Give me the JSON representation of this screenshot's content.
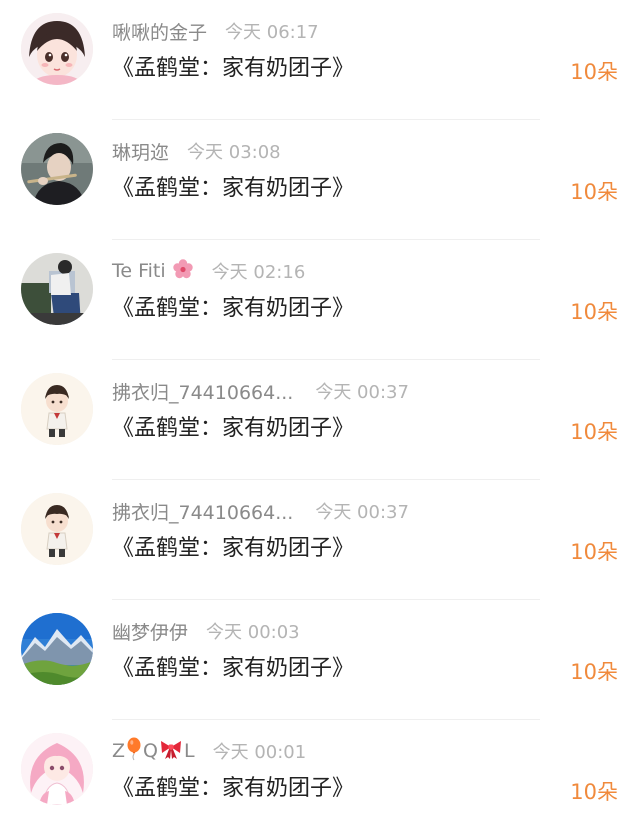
{
  "colors": {
    "username": "#8a8a8a",
    "time": "#b4b4b4",
    "title": "#222222",
    "count": "#f08a3c"
  },
  "rows": [
    {
      "username": "啾啾的金子",
      "time": "今天 06:17",
      "title": "《孟鹤堂：家有奶团子》",
      "count": "10朵",
      "avatar": "cartoon-girl-avatar"
    },
    {
      "username": "琳玥迩",
      "time": "今天 03:08",
      "title": "《孟鹤堂：家有奶团子》",
      "count": "10朵",
      "avatar": "flute-player-avatar"
    },
    {
      "username": "Te Fiti",
      "username_emoji": "flower-icon",
      "time": "今天 02:16",
      "title": "《孟鹤堂：家有奶团子》",
      "count": "10朵",
      "avatar": "photo-person-avatar"
    },
    {
      "username": "拂衣归_74410664...",
      "time": "今天 00:37",
      "title": "《孟鹤堂：家有奶团子》",
      "count": "10朵",
      "avatar": "chibi-boy-avatar"
    },
    {
      "username": "拂衣归_74410664...",
      "time": "今天 00:37",
      "title": "《孟鹤堂：家有奶团子》",
      "count": "10朵",
      "avatar": "chibi-boy-avatar"
    },
    {
      "username": "幽梦伊伊",
      "time": "今天 00:03",
      "title": "《孟鹤堂：家有奶团子》",
      "count": "10朵",
      "avatar": "mountain-landscape-avatar"
    },
    {
      "username_parts": [
        "Z",
        "Q",
        "L"
      ],
      "username_emojis": [
        "balloon-icon",
        "ribbon-icon"
      ],
      "time": "今天 00:01",
      "title": "《孟鹤堂：家有奶团子》",
      "count": "10朵",
      "avatar": "pink-hair-girl-avatar"
    }
  ]
}
